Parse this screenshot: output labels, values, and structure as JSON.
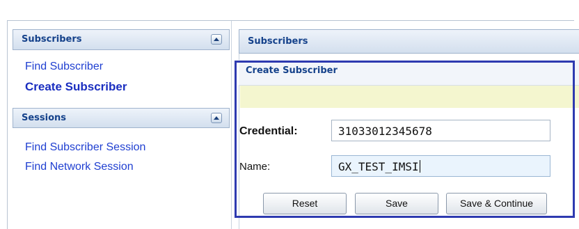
{
  "left_panel": {
    "subscribers": {
      "title": "Subscribers",
      "links": [
        "Find Subscriber",
        "Create Subscriber"
      ]
    },
    "sessions": {
      "title": "Sessions",
      "links": [
        "Find Subscriber Session",
        "Find Network Session"
      ]
    }
  },
  "main": {
    "header": "Subscribers",
    "form_title": "Create Subscriber",
    "credential_label": "Credential:",
    "credential_value": "31033012345678",
    "name_label": "Name:",
    "name_value": "GX_TEST_IMSI",
    "buttons": {
      "reset": "Reset",
      "save": "Save",
      "save_continue": "Save & Continue"
    }
  },
  "colors": {
    "link": "#1f3fd1",
    "header_text": "#15428b",
    "highlight_border": "#2e3ab0",
    "message_bar": "#f4f6cf"
  },
  "icons": [
    "collapse-up-icon"
  ]
}
